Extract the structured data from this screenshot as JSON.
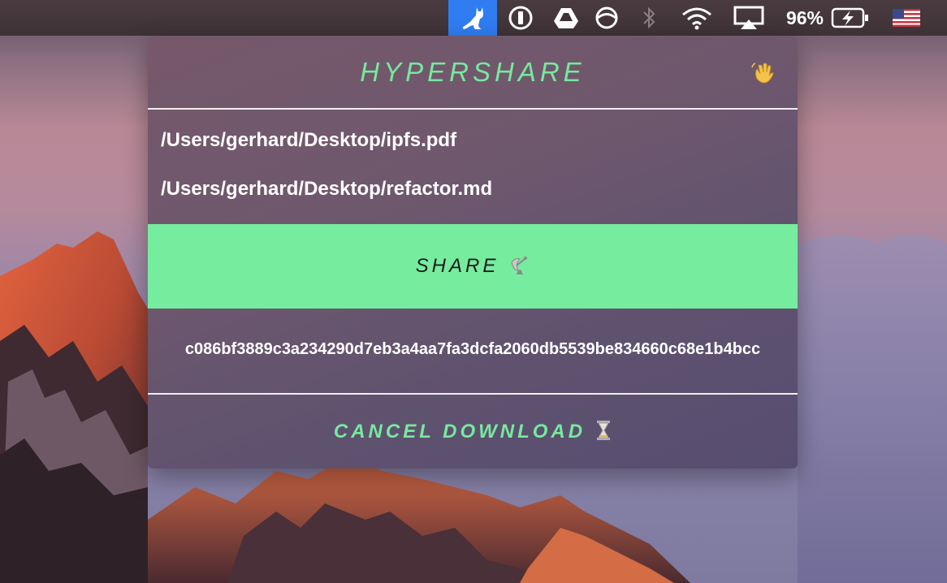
{
  "menubar": {
    "icons": [
      "cat-app-icon",
      "1password-icon",
      "google-drive-icon",
      "sync-icon",
      "bluetooth-icon",
      "wifi-icon",
      "airplay-icon",
      "battery-charging-icon",
      "us-flag-icon"
    ],
    "battery_percent": "96%"
  },
  "panel": {
    "title": "HYPERSHARE",
    "wave_icon": "waving-hand-icon",
    "files": [
      "/Users/gerhard/Desktop/ipfs.pdf",
      "/Users/gerhard/Desktop/refactor.md"
    ],
    "share_label": "SHARE",
    "share_icon": "satellite-antenna-icon",
    "hash": "c086bf3889c3a234290d7eb3a4aa7fa3dcfa2060db5539be834660c68e1b4bcc",
    "cancel_label": "CANCEL DOWNLOAD",
    "cancel_icon": "hourglass-icon"
  },
  "colors": {
    "accent_green": "#76ec9e",
    "menubar_active": "#2f7df1"
  }
}
